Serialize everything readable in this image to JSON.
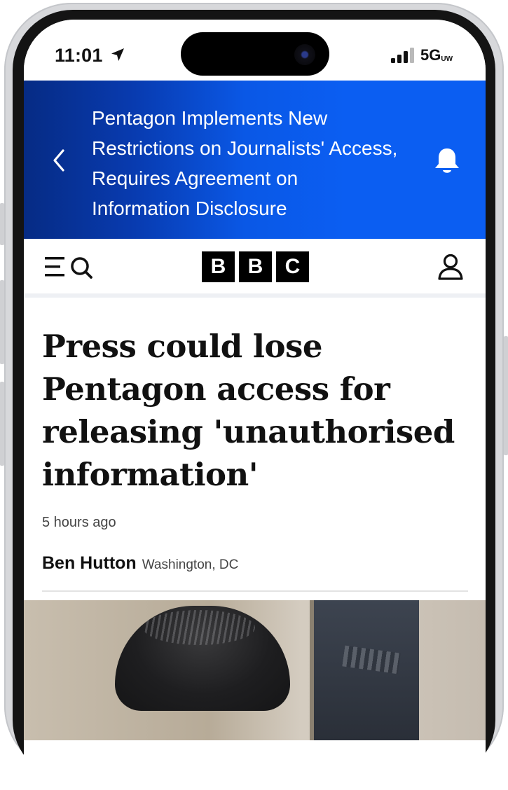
{
  "status_bar": {
    "time": "11:01",
    "network": "5G",
    "network_suffix": "UW",
    "location_icon": "location-arrow-icon",
    "signal_icon": "cellular-signal-icon"
  },
  "banner": {
    "title": "Pentagon Implements New Restrictions on Journalists' Access, Requires Agreement on Information Disclosure",
    "back_icon": "chevron-left-icon",
    "bell_icon": "bell-icon",
    "background": "#0b5ef2"
  },
  "navbar": {
    "menu_icon": "menu-search-icon",
    "logo": [
      "B",
      "B",
      "C"
    ],
    "account_icon": "person-icon"
  },
  "article": {
    "headline": "Press could lose Pentagon access for releasing 'unauthorised information'",
    "timestamp": "5 hours ago",
    "author": "Ben Hutton",
    "location": "Washington, DC"
  }
}
